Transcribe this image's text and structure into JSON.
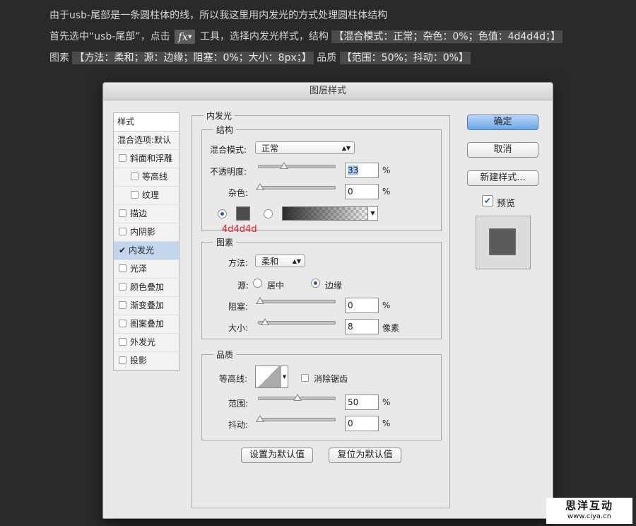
{
  "intro": {
    "line1": "由于usb-尾部是一条圆柱体的线，所以我这里用内发光的方式处理圆柱体结构",
    "line2_a": "首先选中“usb-尾部”，点击",
    "fx_label": "fx",
    "line2_b": "工具，选择内发光样式，结构",
    "line2_hl": "【混合模式：正常；杂色：0%；色值：4d4d4d；】",
    "line3_a": "图素",
    "line3_hl1": "【方法：柔和；源：边缘；阻塞：0%；大小：8px；】",
    "line3_b": "品质",
    "line3_hl2": "【范围：50%；抖动：0%】"
  },
  "dialog": {
    "title": "图层样式",
    "style_list": {
      "header": "样式",
      "blend_options": "混合选项:默认",
      "items": [
        {
          "label": "斜面和浮雕",
          "checked": false
        },
        {
          "label": "等高线",
          "checked": false
        },
        {
          "label": "纹理",
          "checked": false
        },
        {
          "label": "描边",
          "checked": false
        },
        {
          "label": "内阴影",
          "checked": false
        },
        {
          "label": "内发光",
          "checked": true
        },
        {
          "label": "光泽",
          "checked": false
        },
        {
          "label": "颜色叠加",
          "checked": false
        },
        {
          "label": "渐变叠加",
          "checked": false
        },
        {
          "label": "图案叠加",
          "checked": false
        },
        {
          "label": "外发光",
          "checked": false
        },
        {
          "label": "投影",
          "checked": false
        }
      ]
    },
    "panel_title": "内发光",
    "structure": {
      "title": "结构",
      "blend_mode_label": "混合模式:",
      "blend_mode_value": "正常",
      "opacity_label": "不透明度:",
      "opacity_value": "33",
      "noise_label": "杂色:",
      "noise_value": "0",
      "percent": "%",
      "color_annotation": "4d4d4d",
      "color_hex": "#4d4d4d"
    },
    "elements": {
      "title": "图素",
      "method_label": "方法:",
      "method_value": "柔和",
      "source_label": "源:",
      "source_center": "居中",
      "source_edge": "边缘",
      "choke_label": "阻塞:",
      "choke_value": "0",
      "size_label": "大小:",
      "size_value": "8",
      "px_unit": "像素",
      "percent": "%"
    },
    "quality": {
      "title": "品质",
      "contour_label": "等高线:",
      "antialias_label": "消除锯齿",
      "range_label": "范围:",
      "range_value": "50",
      "jitter_label": "抖动:",
      "jitter_value": "0",
      "percent": "%"
    },
    "buttons": {
      "make_default": "设置为默认值",
      "reset_default": "复位为默认值",
      "ok": "确定",
      "cancel": "取消",
      "new_style": "新建样式...",
      "preview_label": "预览"
    }
  },
  "watermark": {
    "line1": "思洋互动",
    "line2": "www.ciya.cn"
  }
}
